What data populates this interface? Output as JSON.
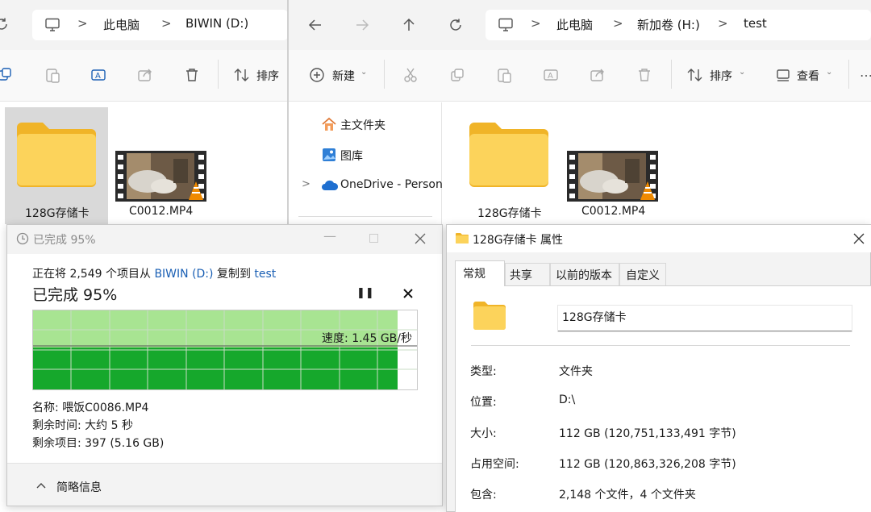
{
  "left_explorer": {
    "breadcrumb": [
      "此电脑",
      "BIWIN (D:)"
    ],
    "toolbar": {
      "sort_label": "排序"
    },
    "items": [
      {
        "name": "128G存储卡",
        "type": "folder"
      },
      {
        "name": "C0012.MP4",
        "type": "video"
      }
    ]
  },
  "right_explorer": {
    "breadcrumb": [
      "此电脑",
      "新加卷 (H:)",
      "test"
    ],
    "toolbar": {
      "new_label": "新建",
      "sort_label": "排序",
      "view_label": "查看"
    },
    "nav": [
      {
        "label": "主文件夹",
        "icon": "home-icon"
      },
      {
        "label": "图库",
        "icon": "gallery-icon"
      },
      {
        "label": "OneDrive - Person",
        "icon": "cloud-icon"
      }
    ],
    "items": [
      {
        "name": "128G存储卡",
        "type": "folder"
      },
      {
        "name": "C0012.MP4",
        "type": "video"
      }
    ]
  },
  "copy_dialog": {
    "title": "已完成 95%",
    "desc_prefix": "正在将 2,549 个项目从 ",
    "source": "BIWIN (D:)",
    "desc_middle": " 复制到 ",
    "destination": "test",
    "heading": "已完成 95%",
    "progress": 0.95,
    "speed": "速度: 1.45 GB/秒",
    "name_line": "名称: 喂饭C0086.MP4",
    "time_line": "剩余时间: 大约 5 秒",
    "items_line": "剩余项目: 397 (5.16 GB)",
    "details_toggle": "简略信息"
  },
  "properties_dialog": {
    "title": "128G存储卡 属性",
    "tabs": [
      "常规",
      "共享",
      "以前的版本",
      "自定义"
    ],
    "active_tab": 0,
    "folder_name": "128G存储卡",
    "rows": [
      {
        "label": "类型:",
        "value": "文件夹"
      },
      {
        "label": "位置:",
        "value": "D:\\"
      },
      {
        "label": "大小:",
        "value": "112 GB (120,751,133,491 字节)"
      },
      {
        "label": "占用空间:",
        "value": "112 GB (120,863,326,208 字节)"
      },
      {
        "label": "包含:",
        "value": "2,148 个文件，4 个文件夹"
      }
    ]
  },
  "colors": {
    "folder_yellow": "#f8c644",
    "progress_green": "#16a82c",
    "graph_light_green": "#a8e492",
    "link_blue": "#1a5fb4"
  }
}
